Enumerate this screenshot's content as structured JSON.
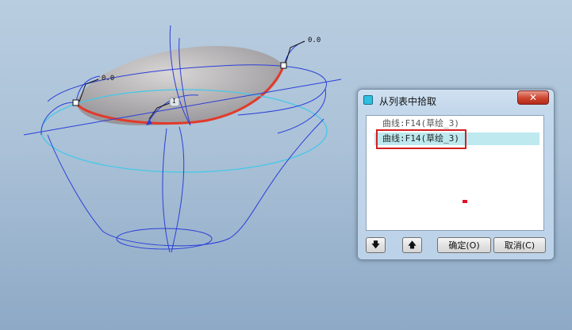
{
  "viewport": {
    "dimension_labels": [
      "0.0",
      "0.0",
      "0.0"
    ],
    "drag_handle_label": "I"
  },
  "dialog": {
    "title": "从列表中拾取",
    "close_label": "✕",
    "items": [
      "曲线:F14(草绘_3)",
      "曲线:F14(草绘_3)"
    ],
    "selected_index": 1,
    "move_down_label": "🡇",
    "move_up_label": "🡅",
    "ok_label": "确定(O)",
    "cancel_label": "取消(C)"
  },
  "colors": {
    "selected_edge": "#e23a2a",
    "wire": "#2a3fd8",
    "section_highlight": "#44c8e8",
    "list_selection": "#bde9ef",
    "annotation_box": "#d32020"
  }
}
